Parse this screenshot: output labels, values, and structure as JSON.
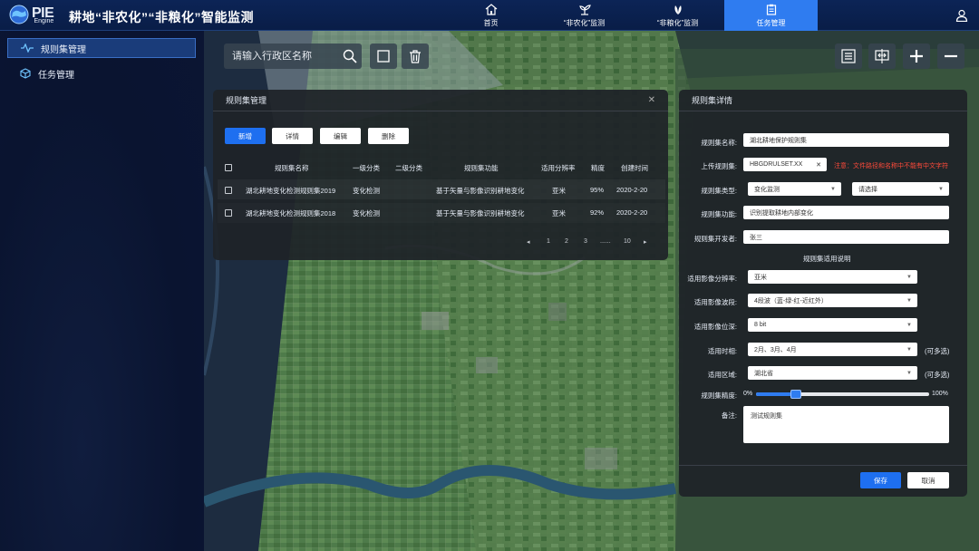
{
  "app": {
    "brand": "PIE",
    "brand_sub": "Engine",
    "title": "耕地“非农化”“非粮化”智能监测"
  },
  "nav": [
    {
      "label": "首页",
      "icon": "home-icon"
    },
    {
      "label": "“非农化”监测",
      "icon": "sprout-icon"
    },
    {
      "label": "“非粮化”监测",
      "icon": "leaf-icon"
    },
    {
      "label": "任务管理",
      "icon": "clipboard-icon"
    }
  ],
  "sidebar": {
    "items": [
      {
        "label": "规则集管理",
        "icon": "pulse-icon"
      },
      {
        "label": "任务管理",
        "icon": "cube-icon"
      }
    ]
  },
  "map_toolbar": {
    "search_placeholder": "请输入行政区名称"
  },
  "rules_panel": {
    "title": "规则集管理",
    "buttons": {
      "add": "新增",
      "detail": "详情",
      "edit": "编辑",
      "delete": "删除"
    },
    "columns": [
      "规则集名称",
      "一级分类",
      "二级分类",
      "规则集功能",
      "适用分辨率",
      "精度",
      "创建时间"
    ],
    "rows": [
      {
        "name": "湖北耕地变化检测规则集2019",
        "level1": "变化检测",
        "level2": "",
        "function": "基于矢量与影像识别耕地变化",
        "resolution": "亚米",
        "precision": "95%",
        "created": "2020-2-20"
      },
      {
        "name": "湖北耕地变化检测规则集2018",
        "level1": "变化检测",
        "level2": "",
        "function": "基于矢量与影像识别耕地变化",
        "resolution": "亚米",
        "precision": "92%",
        "created": "2020-2-20"
      }
    ],
    "pager": {
      "prev": "◂",
      "pages": [
        "1",
        "2",
        "3",
        "......",
        "10"
      ],
      "next": "▸"
    }
  },
  "detail_panel": {
    "title": "规则集详情",
    "name_label": "规则集名称:",
    "name_value": "湖北耕地保护规则集",
    "upload_label": "上传规则集:",
    "upload_value": "HBGDRULSET.XX",
    "upload_note": "注意：文件路径和名称中不能有中文字符",
    "type_label": "规则集类型:",
    "type_value": "变化监测",
    "type_value2": "请选择",
    "function_label": "规则集功能:",
    "function_value": "识别提取耕地内部变化",
    "developer_label": "规则集开发者:",
    "developer_value": "张三",
    "section_title": "规则集适用说明",
    "resolution_label": "适用影像分辨率:",
    "resolution_value": "亚米",
    "band_label": "适用影像波段:",
    "band_value": "4段波（蓝-绿-红-近红外）",
    "depth_label": "适用影像位深:",
    "depth_value": "8 bit",
    "season_label": "适用时相:",
    "season_value": "2月、3月、4月",
    "season_hint": "(可多选)",
    "region_label": "适用区域:",
    "region_value": "湖北省",
    "region_hint": "(可多选)",
    "precision_label": "规则集精度:",
    "precision_min": "0%",
    "precision_max": "100%",
    "precision_fraction": 0.23,
    "remark_label": "备注:",
    "remark_value": "测试规则集",
    "save": "保存",
    "cancel": "取消"
  },
  "colors": {
    "accent": "#2f7cf0",
    "warning": "#ff4a3a",
    "header": "#0c2456"
  }
}
